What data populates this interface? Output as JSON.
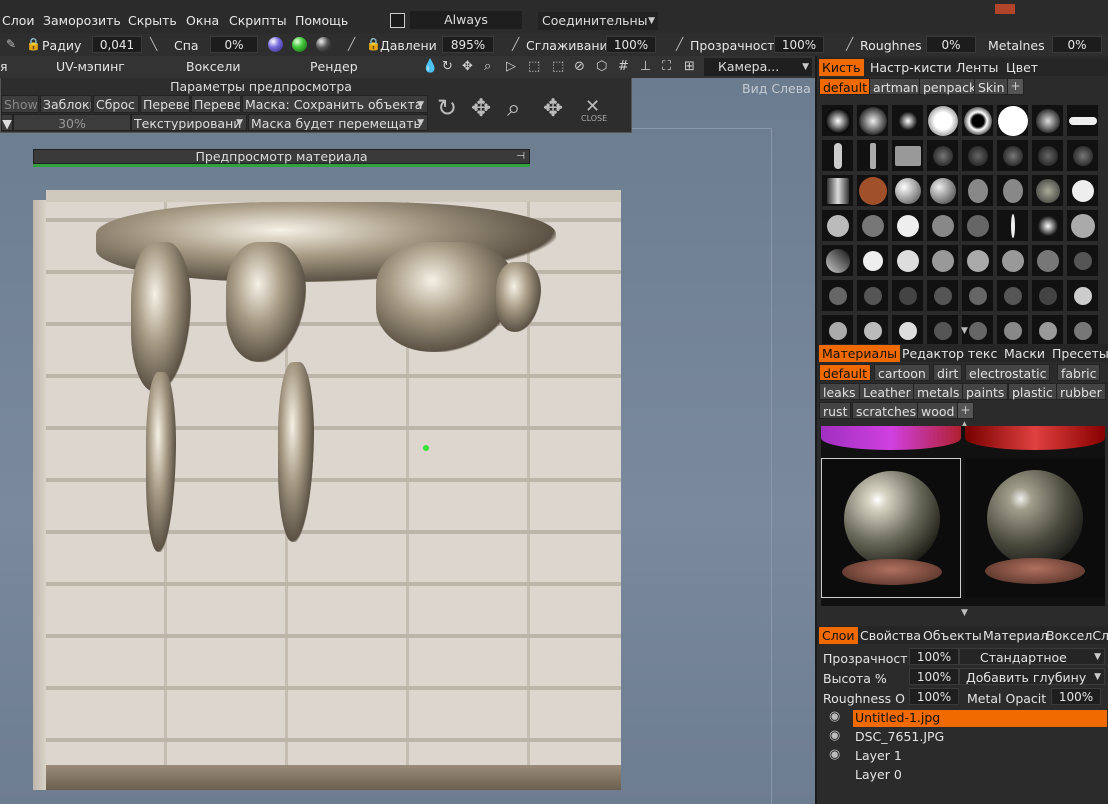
{
  "menu": {
    "items": [
      "Слои",
      "Заморозить",
      "Скрыть",
      "Окна",
      "Скрипты",
      "Помощь"
    ],
    "always": "Always",
    "connective": "Соединительны"
  },
  "params": {
    "radius_label": "Радиу",
    "radius_value": "0,041",
    "spa_label": "Спа",
    "spa_value": "0%",
    "pressure_label": "Давлени",
    "pressure_value": "895%",
    "smooth_label": "Сглаживани",
    "smooth_value": "100%",
    "transparency_label": "Прозрачност",
    "transparency_value": "100%",
    "roughness_label": "Roughnes",
    "roughness_value": "0%",
    "metalness_label": "Metalnes",
    "metalness_value": "0%"
  },
  "rooms": {
    "partial": "я",
    "uv": "UV-мэпинг",
    "voxels": "Воксели",
    "render": "Рендер",
    "camera": "Камера..."
  },
  "viewport": {
    "view_label": "Вид Слева"
  },
  "preview_panel": {
    "title": "Параметры предпросмотра",
    "shown": "Shown",
    "blanks": "Заблоки",
    "reset": "Сброс",
    "flip1": "Перевер",
    "flip2": "Перевер",
    "mask_label": "Маска:",
    "mask_value": "Сохранить объекта",
    "percent": "30%",
    "texturing": "Текстурировани",
    "mask_move": "Маска будет перемещать",
    "close": "CLOSE"
  },
  "material_preview": {
    "title": "Предпросмотр материала"
  },
  "brush_panel": {
    "tabs": [
      "Кисть",
      "Настр-кисти",
      "Ленты",
      "Цвет"
    ],
    "chips": [
      "default",
      "artman",
      "penpack",
      "Skin"
    ]
  },
  "materials_panel": {
    "tabs": [
      "Материалы",
      "Редактор текс",
      "Маски",
      "Пресеты"
    ],
    "chips_row1": [
      "default",
      "cartoon",
      "dirt",
      "electrostatic",
      "fabric"
    ],
    "chips_row2": [
      "leaks",
      "Leather",
      "metals",
      "paints",
      "plastic",
      "rubber"
    ],
    "chips_row3": [
      "rust",
      "scratches",
      "wood"
    ]
  },
  "layers_panel": {
    "tabs": [
      "Слои",
      "Свойства",
      "Объекты",
      "Материал",
      "ВокселСл"
    ],
    "opacity_label": "Прозрачност",
    "opacity_value": "100%",
    "blend": "Стандартное",
    "height_label": "Высота  %",
    "height_value": "100%",
    "depth": "Добавить глубину",
    "rough_label": "Roughness O",
    "rough_value": "100%",
    "metal_label": "Metal Opacit",
    "metal_value": "100%",
    "layers": [
      "Untitled-1.jpg",
      "DSC_7651.JPG",
      "Layer 1",
      "Layer 0"
    ]
  },
  "colors": {
    "accent": "#f06a00",
    "preview_bar": "#30a040",
    "dot": "#37e23a"
  }
}
